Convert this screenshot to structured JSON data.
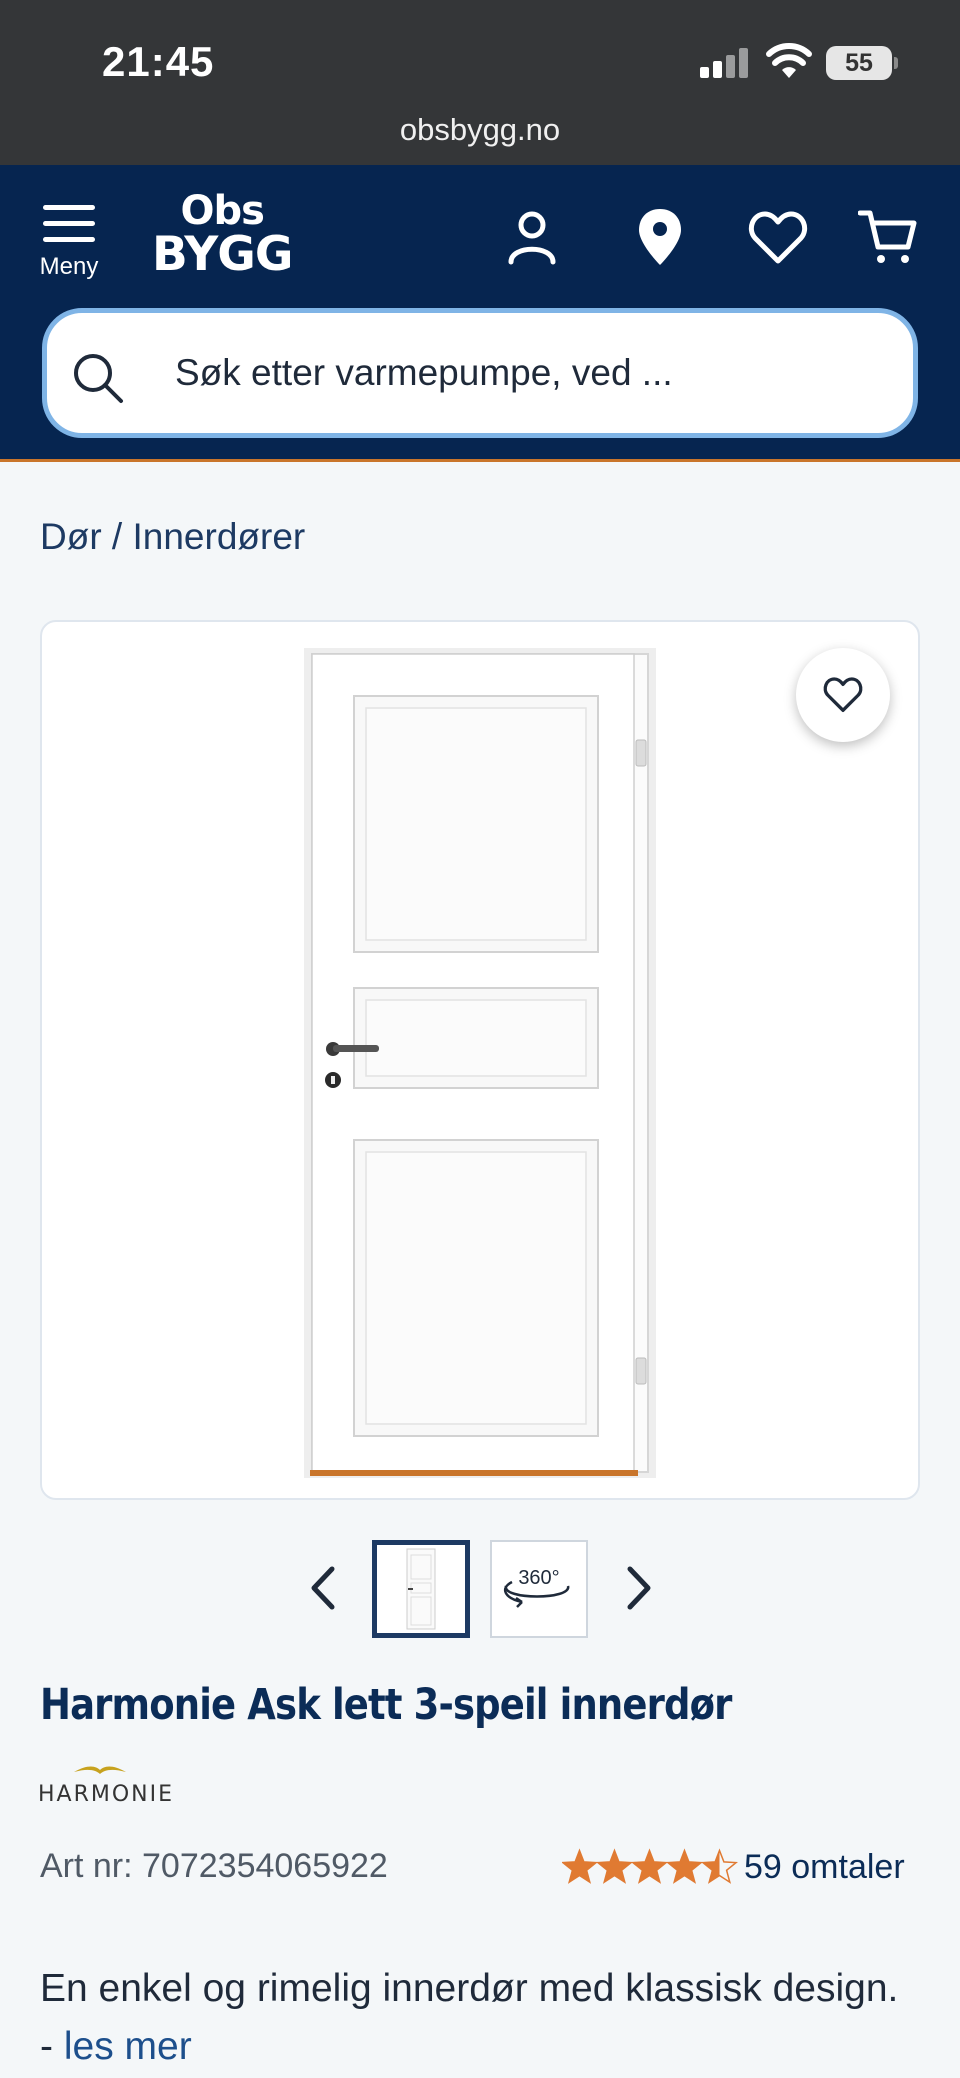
{
  "status_bar": {
    "time": "21:45",
    "battery": "55",
    "url": "obsbygg.no"
  },
  "header": {
    "menu_label": "Meny",
    "logo_top": "Obs",
    "logo_bottom": "BYGG",
    "search_placeholder": "Søk etter varmepumpe, ved ..."
  },
  "breadcrumb": {
    "item1": "Dør",
    "separator": " / ",
    "item2": "Innerdører"
  },
  "product": {
    "title": "Harmonie Ask lett 3-speil innerdør",
    "brand": "HARMONIE",
    "art_nr": "Art nr: 7072354065922",
    "rating": 4.5,
    "rating_max": 5,
    "reviews": "59 omtaler",
    "description": "En enkel og rimelig innerdør med klassisk design. -",
    "read_more": "les mer"
  },
  "carousel": {
    "thumb_360_label": "360°",
    "thumb_count": 2,
    "active_index": 0
  },
  "colors": {
    "navy": "#062550",
    "accent_orange": "#e07a32",
    "link_blue": "#1d4f8c",
    "search_border": "#7fb4e6"
  },
  "icons": [
    "menu-icon",
    "user-icon",
    "location-pin-icon",
    "heart-icon",
    "cart-icon",
    "search-icon",
    "chevron-left-icon",
    "chevron-right-icon",
    "star-icon"
  ]
}
